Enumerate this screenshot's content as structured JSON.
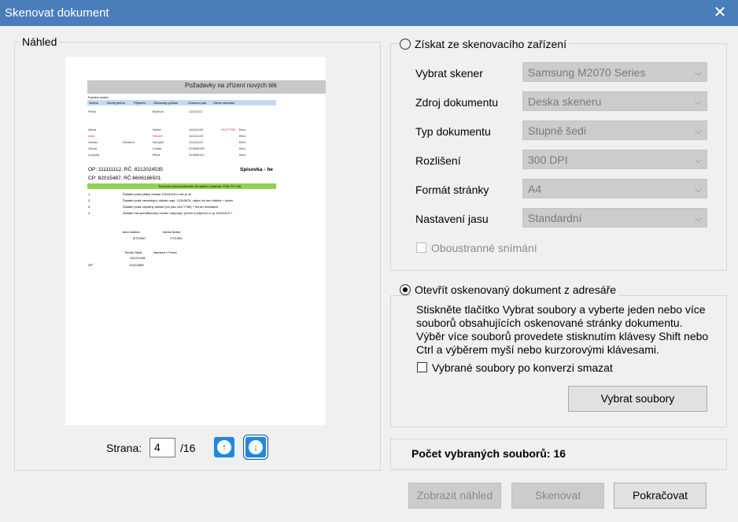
{
  "window": {
    "title": "Skenovat dokument",
    "close_glyph": "✕"
  },
  "preview": {
    "legend": "Náhled",
    "page_label": "Strana:",
    "current_page": "4",
    "total_pages": "/16",
    "doc": {
      "header": "Požadavky na zřízení nových ték",
      "small_label": "Fyzická osoba",
      "columns": [
        "Jméno",
        "Druhé jméno",
        "Příjmení",
        "Občanský průkaz",
        "Cestovní pas",
        "Okres narození"
      ],
      "rows": [
        {
          "name": "Petra",
          "second": "",
          "surname": "Bodová",
          "op": "111111117",
          "pas": "",
          "okres": ""
        },
        {
          "name": "Alena",
          "second": "",
          "surname": "Nutká",
          "op": "111111118",
          "pas": "44477768",
          "okres": "Brno"
        },
        {
          "name": "Artur",
          "second": "",
          "surname": "Neuzel",
          "op": "111111119",
          "pas": "",
          "okres": "Brno"
        },
        {
          "name": "Václav",
          "second": "Klement",
          "surname": "Nevyšel",
          "op": "111111110",
          "pas": "",
          "okres": "Brno"
        },
        {
          "name": "Otmar",
          "second": "",
          "surname": "Kusák",
          "op": "222808332",
          "pas": "",
          "okres": "Brno"
        },
        {
          "name": "Leopold",
          "second": "",
          "surname": "Bříza",
          "op": "222808111",
          "pas": "",
          "okres": "Brno"
        }
      ],
      "op_line1": "OP: 111111112, RČ: 8212024535",
      "op_right": "Spisovka - he",
      "op_line2": "CP: 82015487, RČ:6606166501",
      "green_bar": "Testovací jednoznačného zkrojného čudamie: CR8, RT, MA",
      "items": [
        {
          "n": "1.",
          "t": "Žadatel podá platný doklad 111111118 a vše je ok"
        },
        {
          "n": "2.",
          "t": "Žadatel podá neexistující doklad např. 12345678, objeví se tam hláška + konec"
        },
        {
          "n": "3.",
          "t": "Žadatel podá neplatný doklad (viz pas 44477768) + konec transakce"
        },
        {
          "n": "4.",
          "t": "Žadatel má specifikovaný osobní údaj např. jméno a příjmení a op 111111119 +"
        }
      ],
      "sig1_name": "Jana Nalená",
      "sig1_date": "8/7/1950",
      "sig2_name": "Alena Nutká",
      "sig2_date": "7/7/1960",
      "sig3_name": "Tomáš Opial",
      "sig3_place": "Narozen v Praze",
      "sig3_date": "10/12/1951",
      "op_label": "OP",
      "op_value": "111111889"
    }
  },
  "scanner_section": {
    "radio_label": "Získat ze skenovacího zařízení",
    "selected": false,
    "fields": [
      {
        "label": "Vybrat skener",
        "value": "Samsung M2070 Series"
      },
      {
        "label": "Zdroj dokumentu",
        "value": "Deska skeneru"
      },
      {
        "label": "Typ dokumentu",
        "value": "Stupně šedi"
      },
      {
        "label": "Rozlišení",
        "value": "300 DPI"
      },
      {
        "label": "Formát stránky",
        "value": "A4"
      },
      {
        "label": "Nastavení jasu",
        "value": "Standardní"
      }
    ],
    "duplex_label": "Oboustranné snímání",
    "duplex_checked": false
  },
  "folder_section": {
    "radio_label": "Otevřít oskenovaný dokument z adresáře",
    "selected": true,
    "description": "Stiskněte tlačítko Vybrat soubory a vyberte jeden nebo více souborů obsahujících oskenované stránky dokumentu. Výběr více souborů provedete stisknutím klávesy Shift nebo Ctrl a výběrem myší nebo kurzorovými klávesami.",
    "delete_label": "Vybrané soubory po konverzi smazat",
    "delete_checked": false,
    "select_button": "Vybrat soubory"
  },
  "count": {
    "label": "Počet vybraných souborů: 16"
  },
  "buttons": {
    "preview": "Zobrazit náhled",
    "scan": "Skenovat",
    "continue": "Pokračovat"
  },
  "colors": {
    "titlebar": "#4a7ebb",
    "nav_button": "#1e88e5",
    "preview_header": "#c8c8c8",
    "table_header": "#c6d9f1",
    "green_bar": "#92d050",
    "red_text": "#e03030"
  },
  "icons": {
    "close": "close-icon",
    "up": "arrow-up-circle-icon",
    "down": "arrow-down-circle-icon",
    "combo": "chevron-down-icon"
  }
}
